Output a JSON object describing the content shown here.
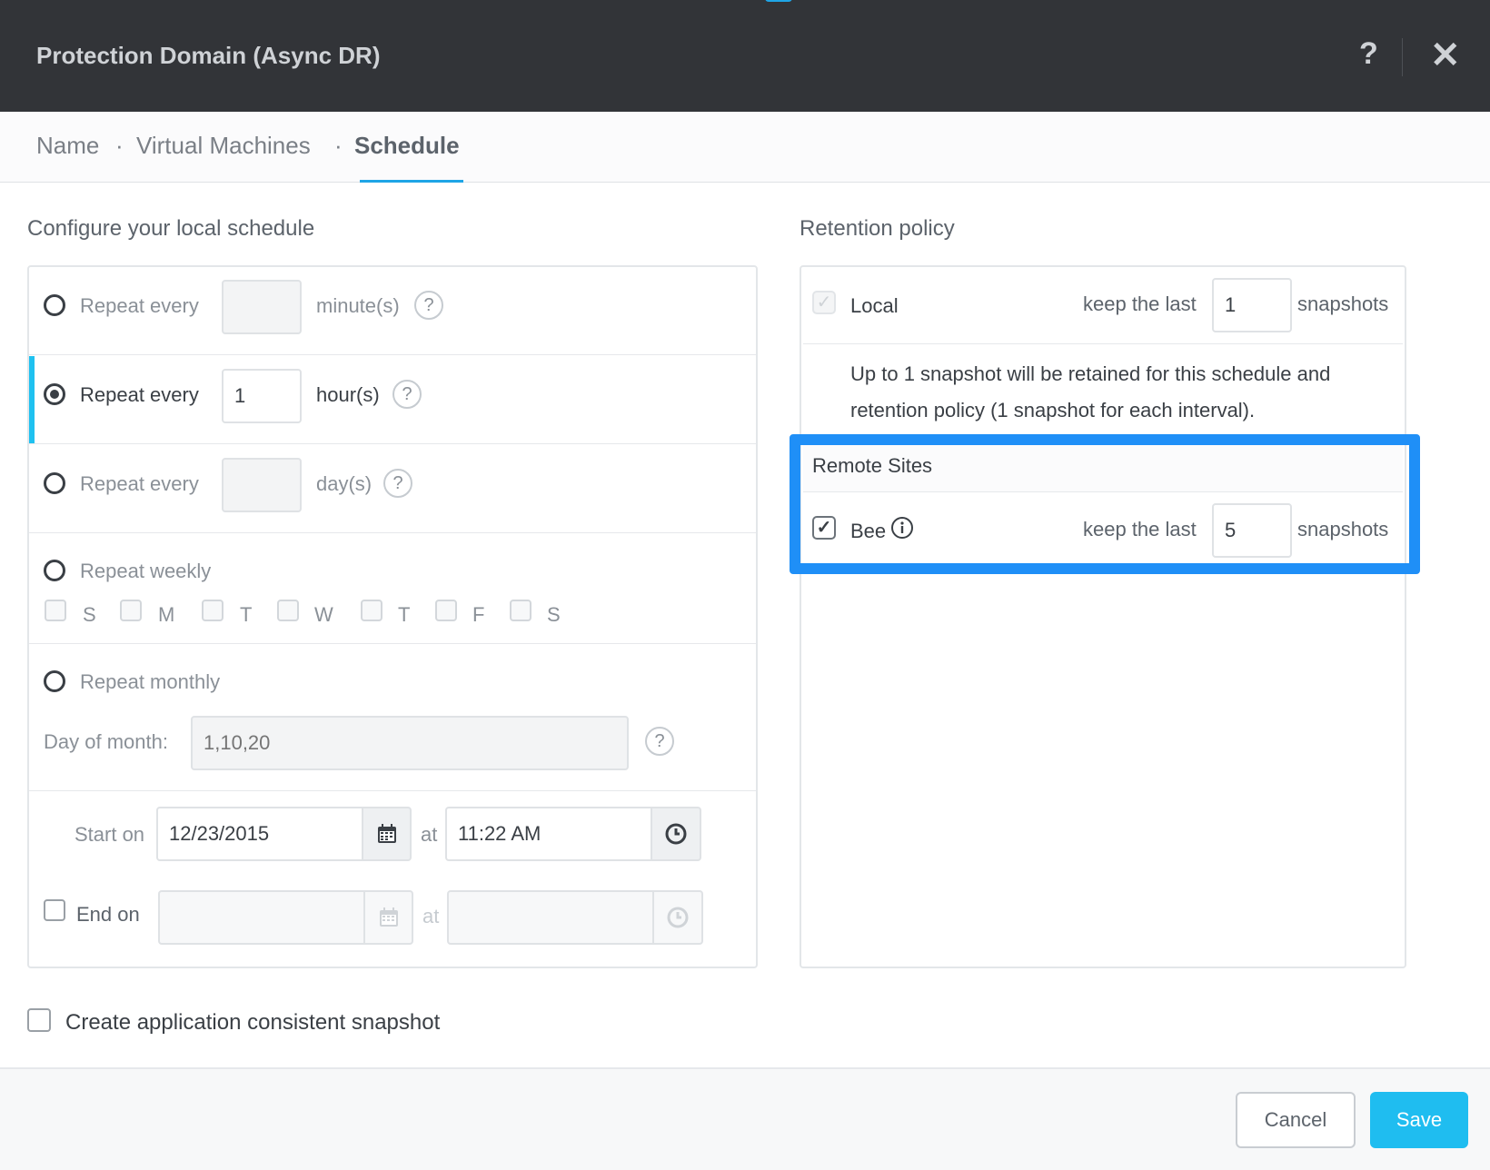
{
  "header": {
    "title": "Protection Domain (Async DR)",
    "help_glyph": "?",
    "close_glyph": "✕"
  },
  "steps": {
    "name": "Name",
    "vms": "Virtual Machines",
    "schedule": "Schedule",
    "separator": "·"
  },
  "local_schedule": {
    "title": "Configure your local schedule",
    "minutes": {
      "label": "Repeat every",
      "value": "",
      "unit": "minute(s)",
      "help": "?"
    },
    "hours": {
      "label": "Repeat every",
      "value": "1",
      "unit": "hour(s)",
      "help": "?"
    },
    "days": {
      "label": "Repeat every",
      "value": "",
      "unit": "day(s)",
      "help": "?"
    },
    "weekly": {
      "label": "Repeat weekly",
      "days": [
        "S",
        "M",
        "T",
        "W",
        "T",
        "F",
        "S"
      ]
    },
    "monthly": {
      "label": "Repeat monthly",
      "day_label": "Day of month:",
      "placeholder": "1,10,20",
      "help": "?"
    },
    "start": {
      "label": "Start on",
      "date": "12/23/2015",
      "at": "at",
      "time": "11:22 AM"
    },
    "end": {
      "label": "End on",
      "date": "",
      "at": "at",
      "time": ""
    }
  },
  "app_consistent": {
    "label": "Create application consistent snapshot"
  },
  "retention": {
    "title": "Retention policy",
    "local": {
      "label": "Local",
      "keep_label": "keep the last",
      "value": "1",
      "unit": "snapshots"
    },
    "note": "Up to 1 snapshot will be retained for this schedule and retention policy (1 snapshot for each interval).",
    "remote_title": "Remote Sites",
    "remote": {
      "label": "Bee",
      "keep_label": "keep the last",
      "value": "5",
      "unit": "snapshots"
    }
  },
  "footer": {
    "cancel": "Cancel",
    "save": "Save"
  },
  "colors": {
    "header_bg": "#323438",
    "accent": "#1fa5e6",
    "highlight": "#1f8ff7",
    "save_bg": "#1fbdf0"
  }
}
